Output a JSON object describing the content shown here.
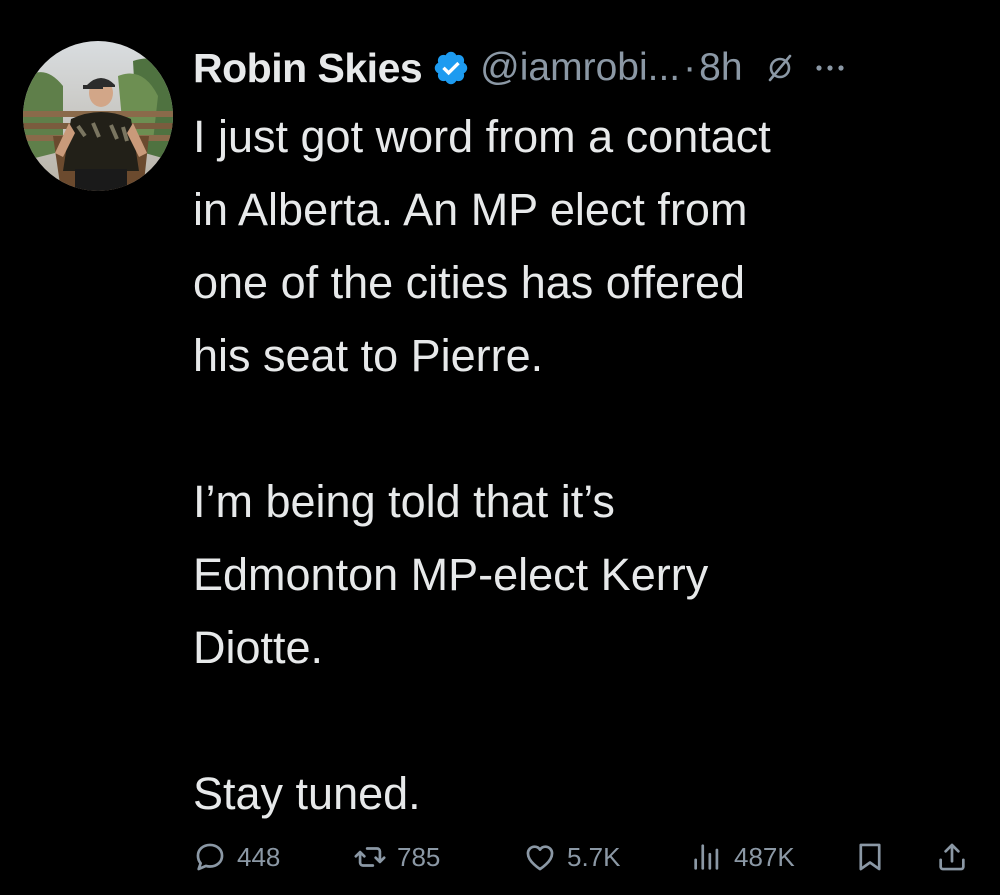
{
  "tweet": {
    "author": {
      "display_name": "Robin Skies",
      "handle": "@iamrobi...",
      "verified": true
    },
    "separator": "·",
    "time": "8h",
    "body": {
      "lines_p1": [
        "I just got word from a contact",
        "in Alberta. An MP elect from",
        "one of the cities has offered",
        "his seat to Pierre."
      ],
      "lines_p2": [
        "I’m being told that it’s",
        "Edmonton MP-elect Kerry",
        "Diotte."
      ],
      "lines_p3": [
        "Stay tuned."
      ]
    },
    "actions": {
      "replies": "448",
      "reposts": "785",
      "likes": "5.7K",
      "views": "487K"
    }
  },
  "colors": {
    "background": "#000000",
    "text": "#e7e9ea",
    "secondary": "#8b98a5",
    "verified_badge": "#1d9bf0"
  },
  "icons": {
    "verified": "verified-badge-icon",
    "grok": "grok-icon",
    "more": "more-dots-icon",
    "reply": "reply-bubble-icon",
    "repost": "repost-arrows-icon",
    "like": "heart-icon",
    "views": "bar-chart-icon",
    "bookmark": "bookmark-icon",
    "share": "share-upload-icon"
  }
}
